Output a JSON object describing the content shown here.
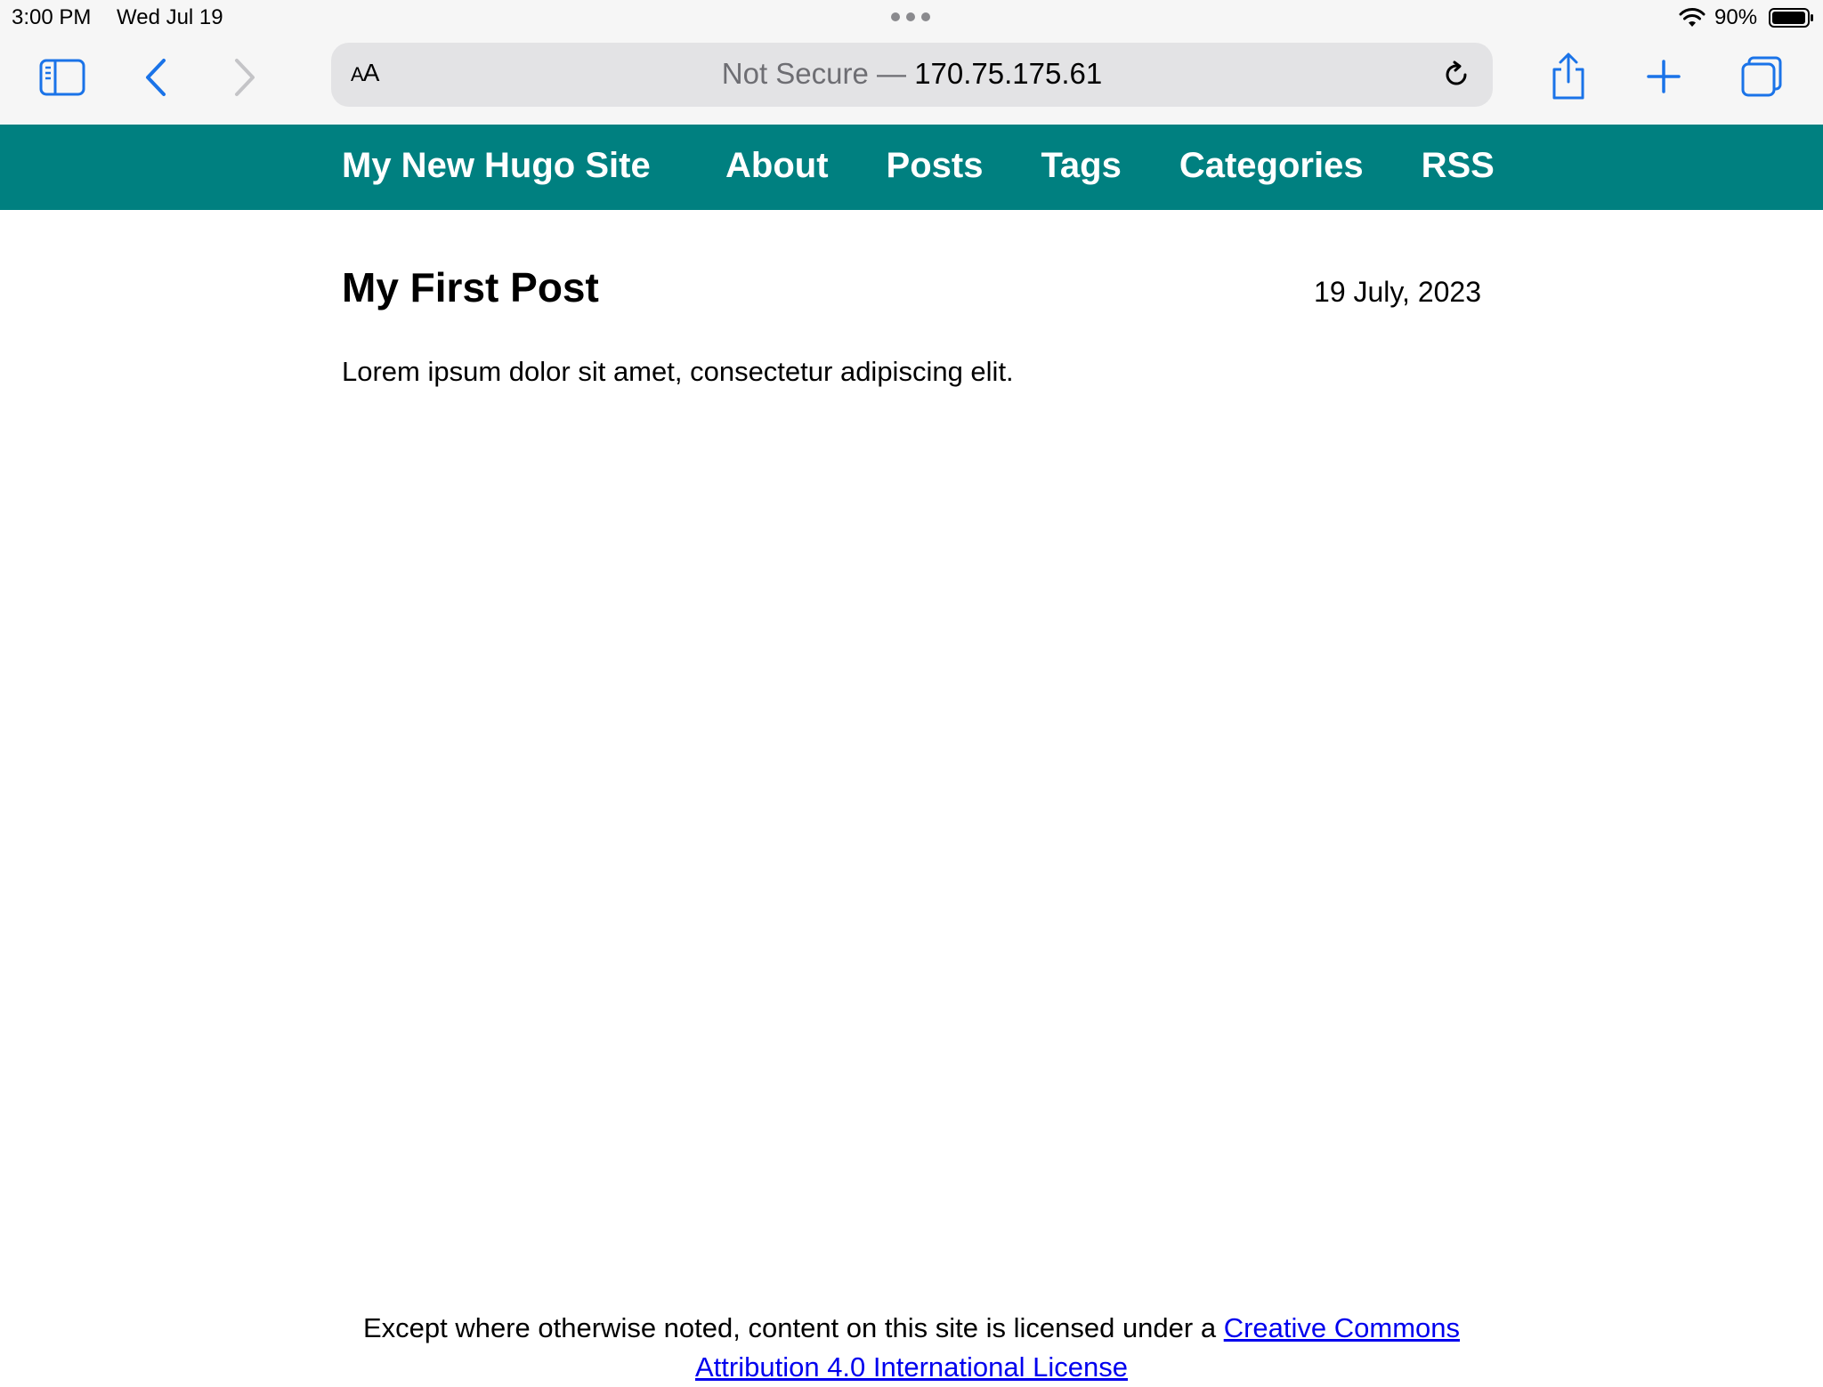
{
  "status_bar": {
    "time": "3:00 PM",
    "date": "Wed Jul 19",
    "battery": "90%"
  },
  "browser": {
    "reader_label_small": "A",
    "reader_label_large": "A",
    "url_security": "Not Secure —",
    "url_host": "170.75.175.61",
    "icons": [
      "sidebar-icon",
      "back-icon",
      "forward-icon",
      "reload-icon",
      "share-icon",
      "new-tab-icon",
      "tabs-icon"
    ]
  },
  "site": {
    "title": "My New Hugo Site",
    "nav": [
      "About",
      "Posts",
      "Tags",
      "Categories",
      "RSS"
    ],
    "accent_color": "#008080"
  },
  "post": {
    "title": "My First Post",
    "date": "19 July, 2023",
    "body": "Lorem ipsum dolor sit amet, consectetur adipiscing elit."
  },
  "footer": {
    "text": "Except where otherwise noted, content on this site is licensed under a",
    "link_text": "Creative Commons Attribution 4.0 International License",
    "link_color": "#0000ee"
  }
}
